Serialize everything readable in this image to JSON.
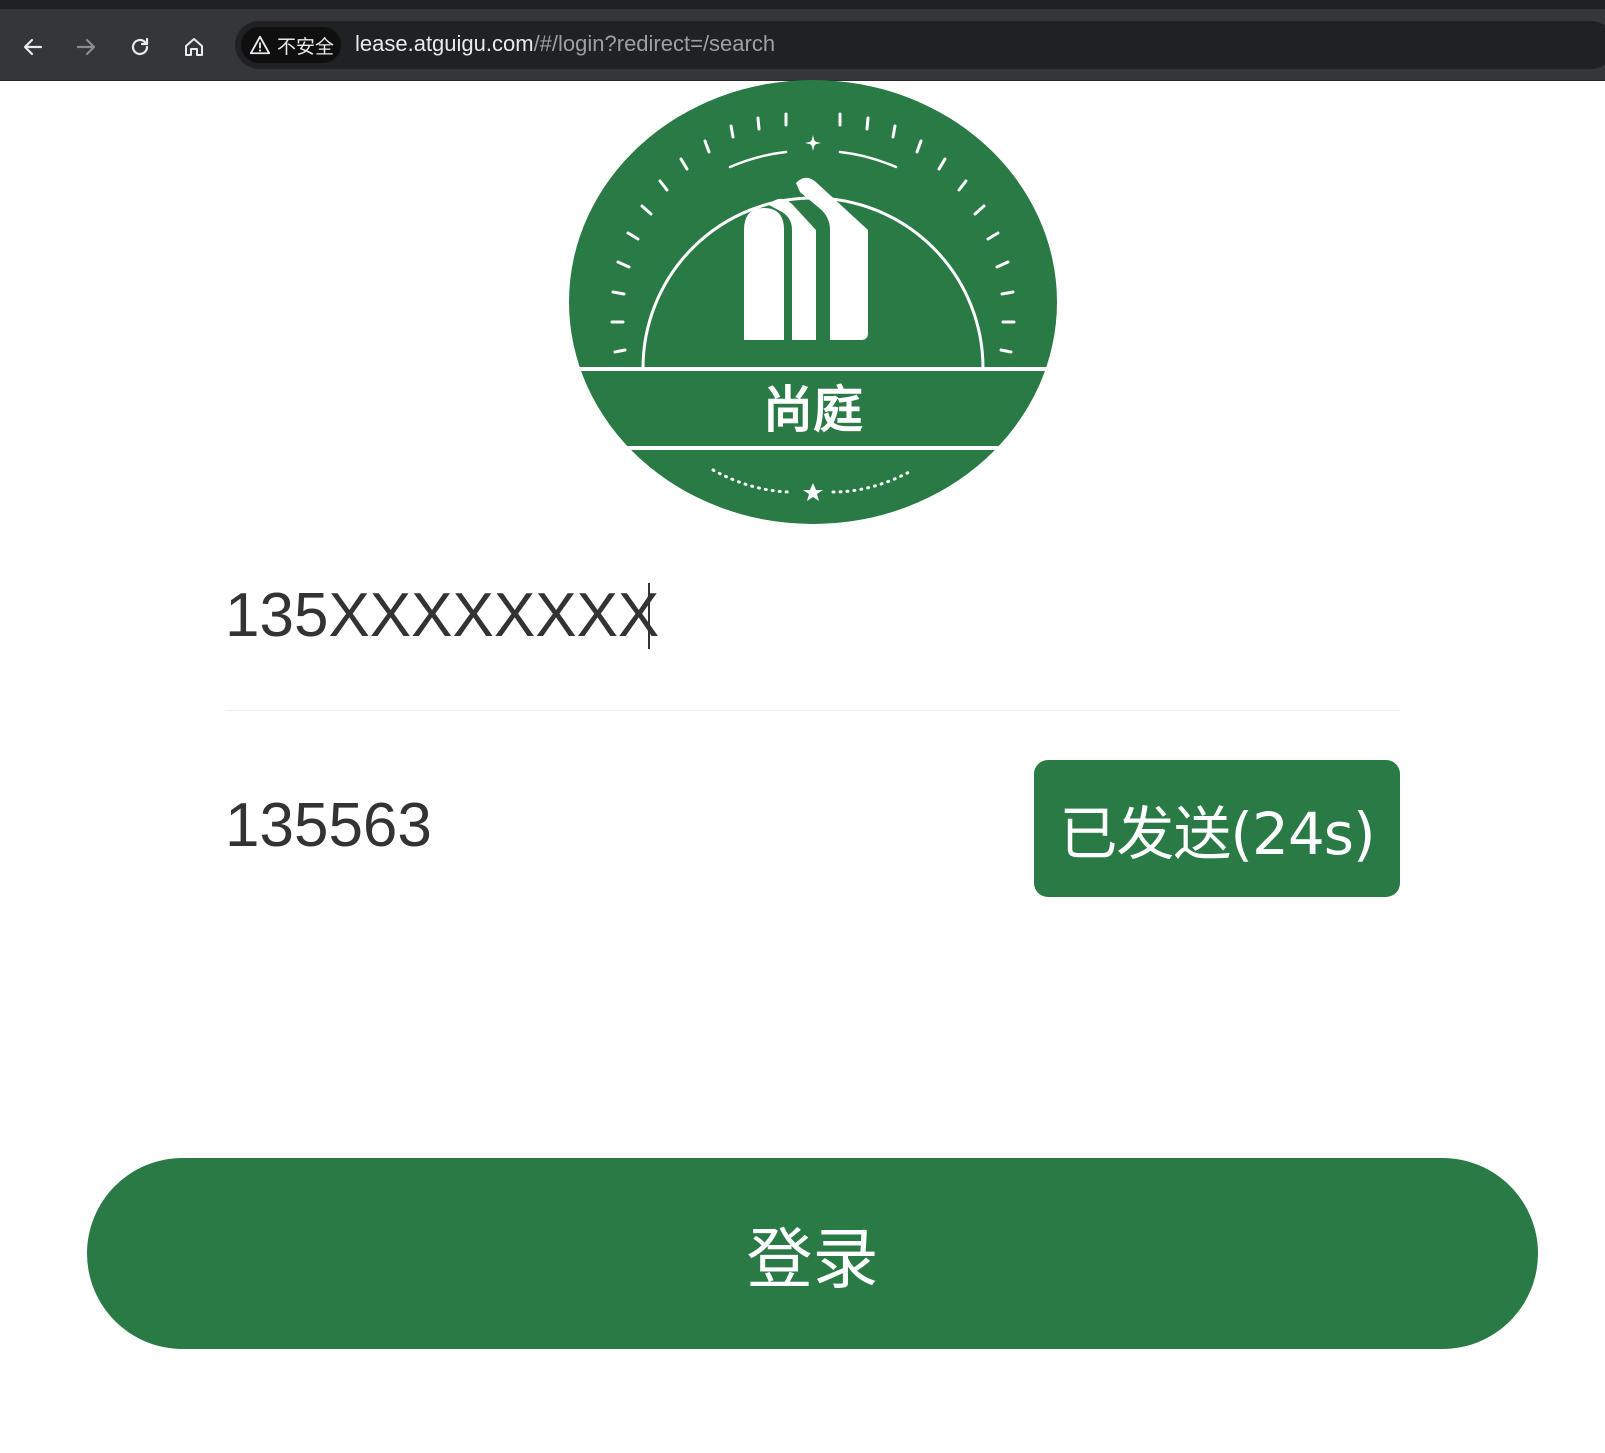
{
  "browser": {
    "security_label": "不安全",
    "url_host": "lease.atguigu.com",
    "url_path": "/#/login?redirect=/search"
  },
  "logo": {
    "brand_text": "尚庭",
    "brand_color": "#297a45"
  },
  "form": {
    "phone_value": "135XXXXXXXX",
    "code_value": "135563",
    "send_code_label": "已发送(24s)",
    "login_label": "登录"
  },
  "colors": {
    "accent": "#297a45",
    "browser_bar": "#35363a"
  }
}
